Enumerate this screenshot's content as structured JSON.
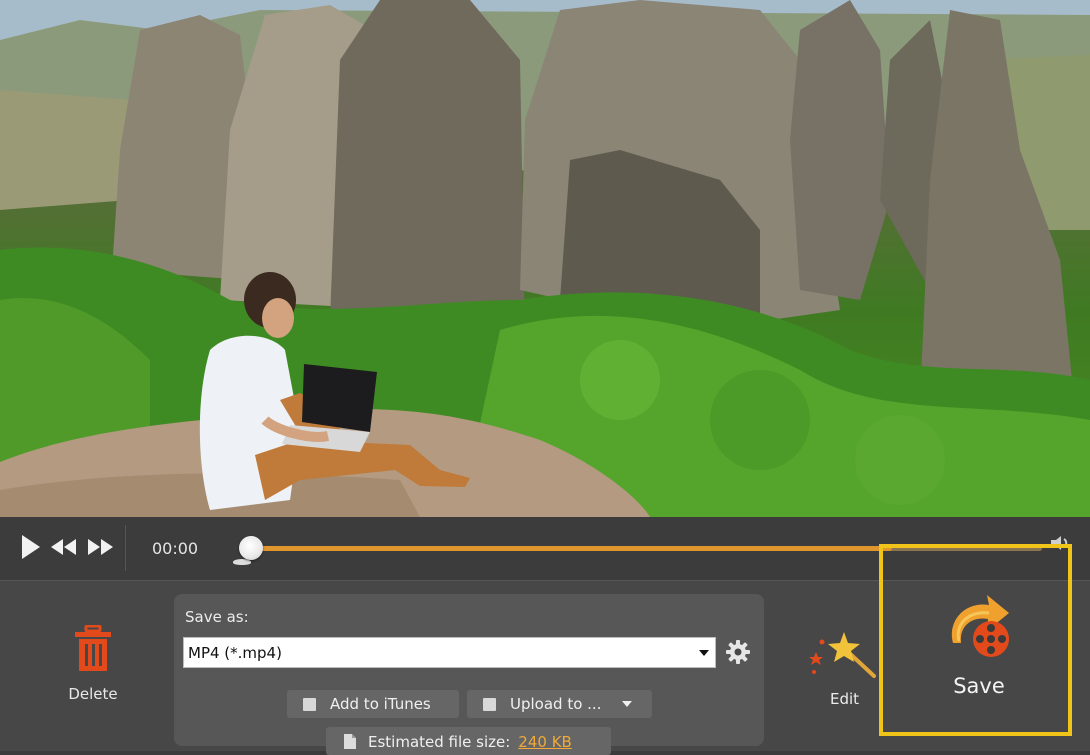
{
  "player": {
    "time": "00:00",
    "progress": 0.81
  },
  "actions": {
    "delete_label": "Delete",
    "edit_label": "Edit",
    "save_label": "Save"
  },
  "save_panel": {
    "label": "Save as:",
    "format_value": "MP4 (*.mp4)",
    "add_itunes_label": "Add to iTunes",
    "upload_label": "Upload to ...",
    "estimated_label": "Estimated file size:",
    "estimated_value": "240 KB"
  },
  "colors": {
    "accent_orange": "#e0952d",
    "highlight_yellow": "#f0c419",
    "delete_red": "#e24a1c",
    "link_orange": "#f0a93a"
  },
  "icons": {
    "play": "play-icon",
    "rewind": "rewind-icon",
    "fast_forward": "fast-forward-icon",
    "volume": "volume-icon",
    "delete": "trash-icon",
    "settings": "gear-icon",
    "edit": "magic-wand-icon",
    "save": "save-film-icon",
    "estimate": "document-icon"
  }
}
